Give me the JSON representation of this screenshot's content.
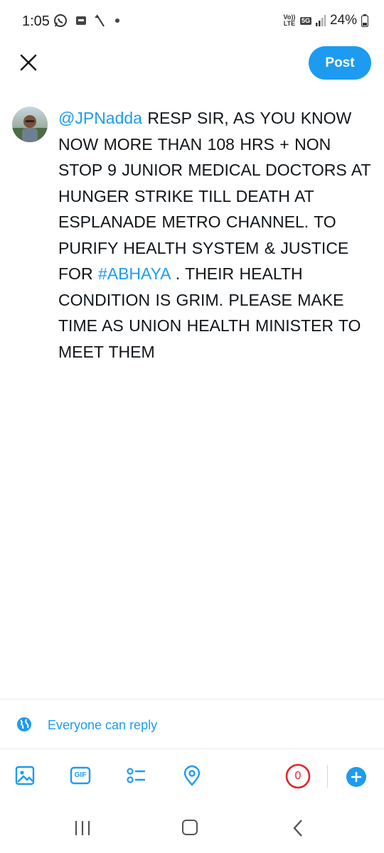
{
  "status_bar": {
    "time": "1:05",
    "network_label": "Vo)) LTE",
    "network_type": "5G",
    "battery": "24%"
  },
  "header": {
    "post_label": "Post",
    "accent_color": "#1d9bf0"
  },
  "tweet": {
    "avatar_icon": "user-avatar",
    "segments": [
      {
        "text": "@JPNadda",
        "link": true
      },
      {
        "text": " RESP SIR,  AS YOU KNOW NOW MORE THAN 108 HRS + NON STOP 9 JUNIOR MEDICAL DOCTORS AT HUNGER STRIKE TILL DEATH AT ESPLANADE METRO CHANNEL. TO PURIFY HEALTH SYSTEM & JUSTICE FOR ",
        "link": false
      },
      {
        "text": "#ABHAYA",
        "link": true
      },
      {
        "text": " . THEIR HEALTH CONDITION IS GRIM. PLEASE MAKE TIME AS UNION HEALTH MINISTER TO MEET THEM",
        "link": false
      }
    ]
  },
  "reply_settings": {
    "label": "Everyone can reply"
  },
  "toolbar": {
    "icons": [
      "image-icon",
      "gif-icon",
      "poll-icon",
      "location-icon"
    ],
    "gif_label": "GIF",
    "char_counter": "0",
    "counter_color": "#e0242b"
  }
}
